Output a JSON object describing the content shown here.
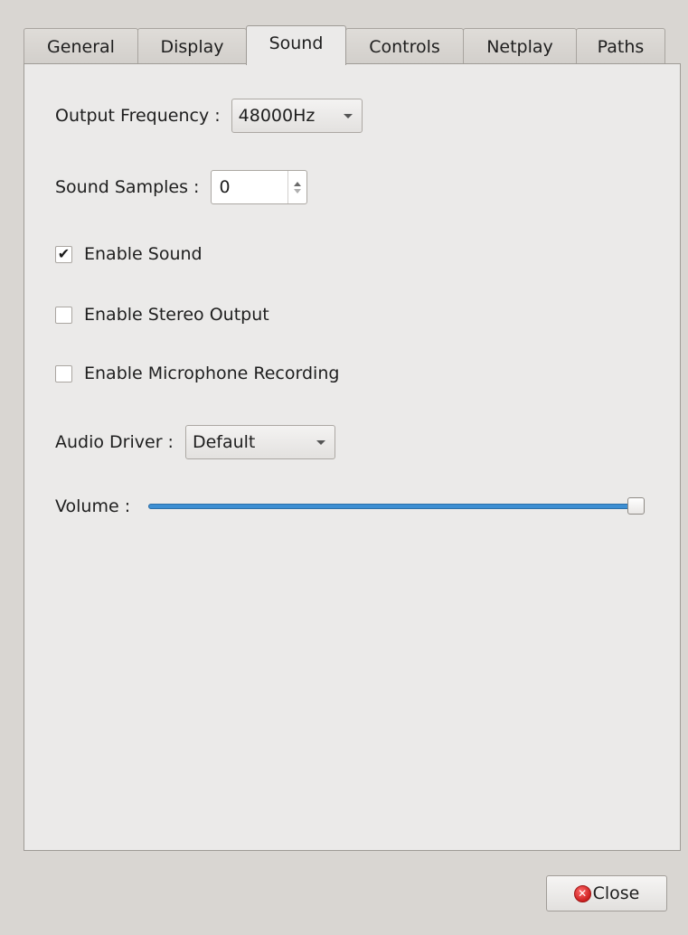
{
  "tabs": [
    {
      "label": "General"
    },
    {
      "label": "Display"
    },
    {
      "label": "Sound"
    },
    {
      "label": "Controls"
    },
    {
      "label": "Netplay"
    },
    {
      "label": "Paths"
    }
  ],
  "active_tab": "Sound",
  "sound": {
    "output_frequency": {
      "label": "Output Frequency :",
      "value": "48000Hz"
    },
    "sound_samples": {
      "label": "Sound Samples :",
      "value": "0"
    },
    "enable_sound": {
      "label": "Enable Sound",
      "checked": true
    },
    "enable_stereo": {
      "label": "Enable Stereo Output",
      "checked": false
    },
    "enable_microphone": {
      "label": "Enable Microphone Recording",
      "checked": false
    },
    "audio_driver": {
      "label": "Audio Driver :",
      "value": "Default"
    },
    "volume": {
      "label": "Volume :",
      "level_percent": 100
    }
  },
  "footer": {
    "close_label": "Close"
  },
  "colors": {
    "accent": "#3d8fd3",
    "close_icon": "#cc1f1f"
  }
}
